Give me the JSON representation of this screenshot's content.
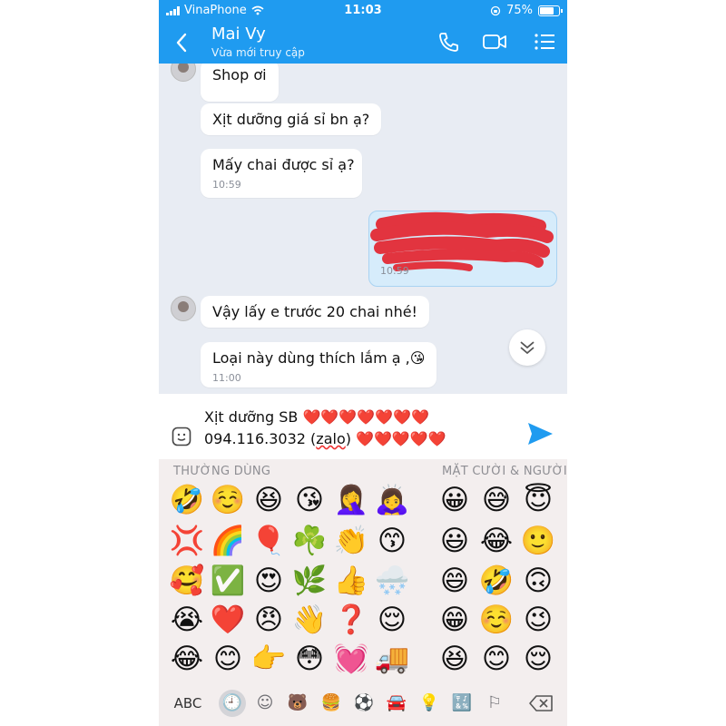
{
  "status": {
    "carrier": "VinaPhone",
    "time": "11:03",
    "battery": "75%"
  },
  "header": {
    "title": "Mai Vy",
    "subtitle": "Vừa mới truy cập"
  },
  "messages": {
    "m1": "Shop ơi",
    "m2": "Xịt dưỡng giá sỉ bn ạ?",
    "m3": "Mấy chai được sỉ ạ?",
    "m3_time": "10:59",
    "sent_time": "10:59",
    "m4": "Vậy lấy e trước 20 chai nhé!",
    "m5": "Loại này dùng thích lắm ạ ,😘",
    "m5_time": "11:00"
  },
  "composer": {
    "line1": "Xịt dưỡng SB ❤️❤️❤️❤️❤️❤️❤️",
    "line2_pre": "094.116.3032 (",
    "line2_zalo": "zalo",
    "line2_post": ") ❤️❤️❤️❤️❤️"
  },
  "keyboard": {
    "section_frequent": "THƯỜNG DÙNG",
    "section_smileys": "MẶT CƯỜI & NGƯỜI",
    "abc_label": "ABC",
    "frequent": [
      [
        "🤣",
        "☺️",
        "😆",
        "😘",
        "🤦‍♀️",
        "🙇‍♀️"
      ],
      [
        "💢",
        "🌈",
        "🎈",
        "☘️",
        "👏",
        "😙"
      ],
      [
        "🥰",
        "✅",
        "😍",
        "🌿",
        "👍",
        "🌨️"
      ],
      [
        "😭",
        "❤️",
        "😠",
        "👋",
        "❓",
        "😌"
      ],
      [
        "😂",
        "😊",
        "👉",
        "😳",
        "💓",
        "🚚"
      ]
    ],
    "smileys": [
      [
        "😀",
        "😅",
        "😇"
      ],
      [
        "😃",
        "😂",
        "🙂"
      ],
      [
        "😄",
        "🤣",
        "🙃"
      ],
      [
        "😁",
        "☺️",
        "😉"
      ],
      [
        "😆",
        "😊",
        "😌"
      ]
    ],
    "categories": [
      "🕘",
      "☺",
      "🐻",
      "🍔",
      "⚽",
      "🚘",
      "💡",
      "🔣",
      "⚐"
    ]
  }
}
